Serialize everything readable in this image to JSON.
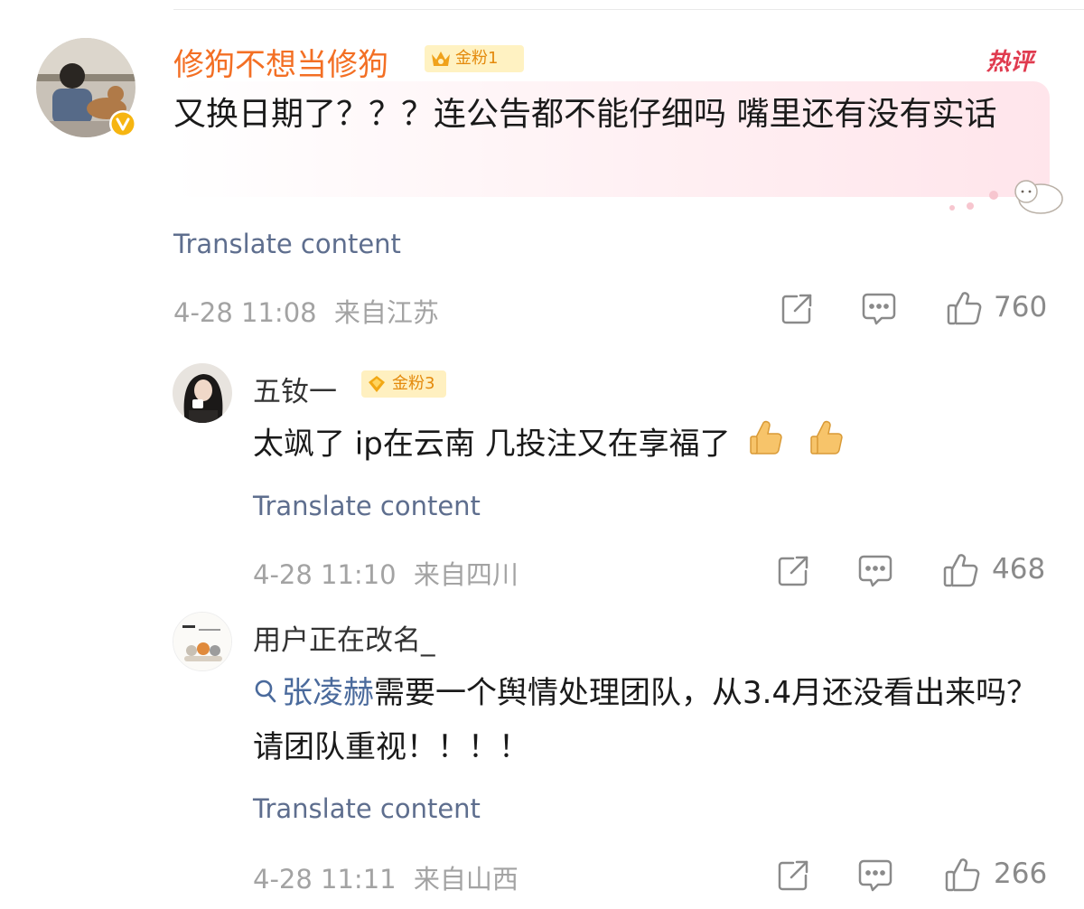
{
  "comments": [
    {
      "user": "修狗不想当修狗",
      "badge": "金粉1",
      "hot_label": "热评",
      "text": "又换日期了？？？连公告都不能仔细吗 嘴里还有没有实话",
      "translate": "Translate content",
      "time": "4-28 11:08",
      "location": "来自江苏",
      "likes": "760"
    },
    {
      "user": "五钕一",
      "badge": "金粉3",
      "text": "太飒了 ip在云南 几投注又在享福了",
      "translate": "Translate content",
      "time": "4-28 11:10",
      "location": "来自四川",
      "likes": "468"
    },
    {
      "user": "用户正在改名_",
      "mention": "张凌赫",
      "text": "需要一个舆情处理团队，从3.4月还没看出来吗？请团队重视！！！！",
      "translate": "Translate content",
      "time": "4-28 11:11",
      "location": "来自山西",
      "likes": "266"
    }
  ],
  "icons": {
    "share": "share-icon",
    "comment": "comment-icon",
    "like": "thumbs-up-icon",
    "verified": "verified-v-icon",
    "search": "search-icon"
  },
  "colors": {
    "username_vip": "#f36f24",
    "link": "#5e6e8e",
    "meta": "#a3a3a3",
    "badge_bg": "#fff2c2",
    "hot_tag": "#e03b4f"
  }
}
